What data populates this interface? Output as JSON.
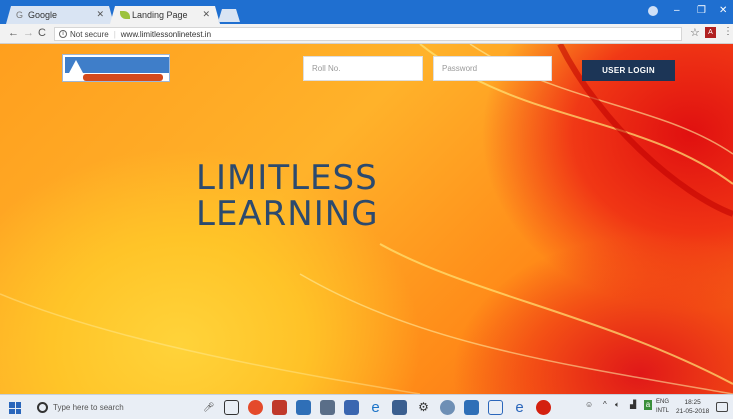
{
  "browser": {
    "tabs": [
      {
        "label": "Google",
        "favicon": "google-icon"
      },
      {
        "label": "Landing Page",
        "favicon": "leaf-icon"
      }
    ],
    "security_label": "Not secure",
    "url": "www.limitlessonlinetest.in"
  },
  "page": {
    "logo_text": "LIMITLESS LEARNING",
    "roll_placeholder": "Roll No.",
    "password_placeholder": "Password",
    "login_label": "USER LOGIN",
    "headline_line1": "LIMITLESS",
    "headline_line2": "LEARNING"
  },
  "taskbar": {
    "search_placeholder": "Type here to search",
    "language_line1": "ENG",
    "language_line2": "INTL",
    "time": "18:25",
    "date": "21-05-2018"
  },
  "colors": {
    "login_button": "#1c3556",
    "headline": "#2c4a6e",
    "titlebar": "#1f6fd0"
  }
}
